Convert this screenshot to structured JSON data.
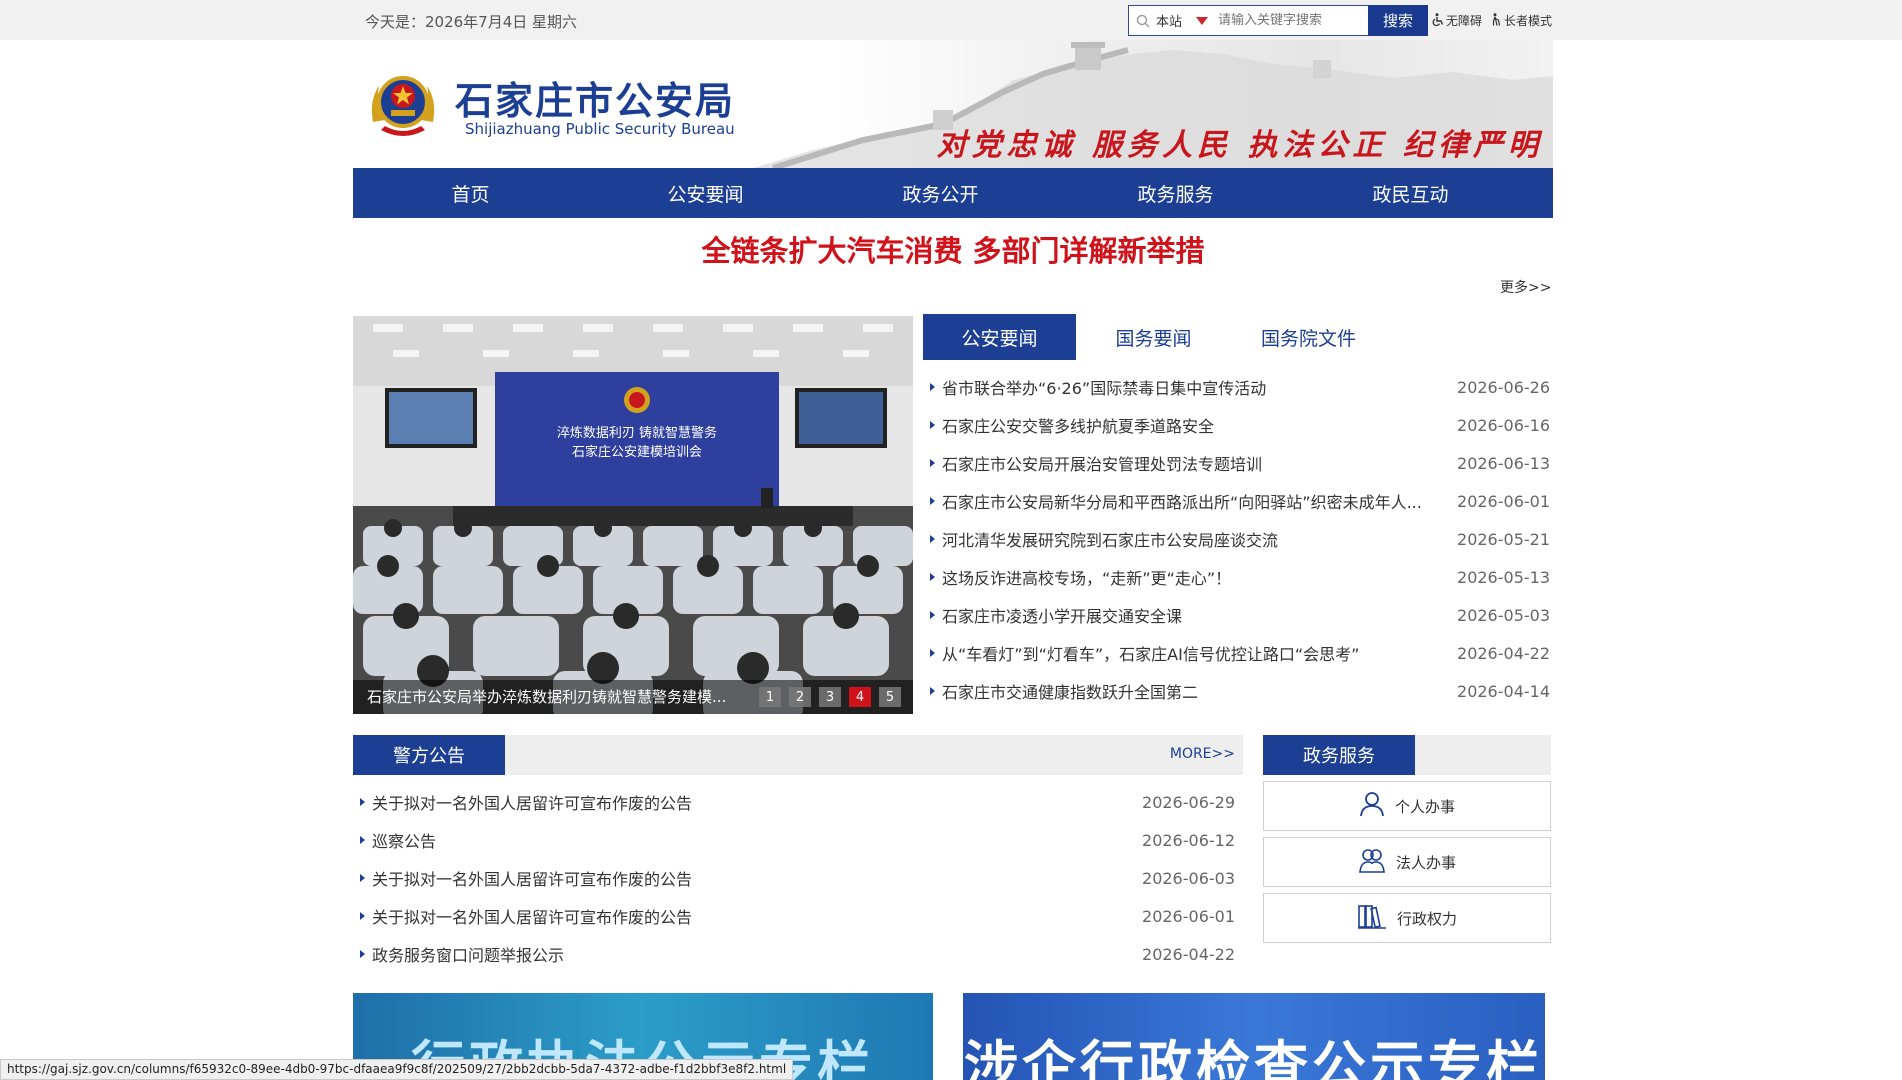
{
  "topbar": {
    "date": "今天是：2026年7月4日 星期六",
    "search_scope": "本站",
    "search_placeholder": "请输入关键字搜索",
    "search_button": "搜索",
    "accessibility_link": "无障碍",
    "elder_mode_link": "长者模式"
  },
  "header": {
    "title": "石家庄市公安局",
    "subtitle": "Shijiazhuang Public Security Bureau",
    "slogan": "对党忠诚 服务人民 执法公正 纪律严明"
  },
  "nav": {
    "items": [
      {
        "label": "首页"
      },
      {
        "label": "公安要闻"
      },
      {
        "label": "政务公开"
      },
      {
        "label": "政务服务"
      },
      {
        "label": "政民互动"
      }
    ]
  },
  "headline": {
    "text": "全链条扩大汽车消费 多部门详解新举措",
    "more": "更多>>"
  },
  "carousel": {
    "screen_text_line1": "淬炼数据利刃 铸就智慧警务",
    "screen_text_line2": "石家庄公安建模培训会",
    "caption": "石家庄市公安局举办淬炼数据利刃铸就智慧警务建模...",
    "pages": [
      "1",
      "2",
      "3",
      "4",
      "5"
    ],
    "active_page": 4
  },
  "news": {
    "tabs": [
      {
        "label": "公安要闻",
        "active": true
      },
      {
        "label": "国务要闻",
        "active": false
      },
      {
        "label": "国务院文件",
        "active": false
      }
    ],
    "items": [
      {
        "title": "省市联合举办“6·26”国际禁毒日集中宣传活动",
        "date": "2026-06-26"
      },
      {
        "title": "石家庄公安交警多线护航夏季道路安全",
        "date": "2026-06-16"
      },
      {
        "title": "石家庄市公安局开展治安管理处罚法专题培训",
        "date": "2026-06-13"
      },
      {
        "title": "石家庄市公安局新华分局和平西路派出所“向阳驿站”织密未成年人...",
        "date": "2026-06-01"
      },
      {
        "title": "河北清华发展研究院到石家庄市公安局座谈交流",
        "date": "2026-05-21"
      },
      {
        "title": "这场反诈进高校专场，“走新”更“走心”！",
        "date": "2026-05-13"
      },
      {
        "title": "石家庄市凌透小学开展交通安全课",
        "date": "2026-05-03"
      },
      {
        "title": "从“车看灯”到“灯看车”，石家庄AI信号优控让路口“会思考”",
        "date": "2026-04-22"
      },
      {
        "title": "石家庄市交通健康指数跃升全国第二",
        "date": "2026-04-14"
      }
    ]
  },
  "notices": {
    "title": "警方公告",
    "more": "MORE>>",
    "items": [
      {
        "title": "关于拟对一名外国人居留许可宣布作废的公告",
        "date": "2026-06-29"
      },
      {
        "title": "巡察公告",
        "date": "2026-06-12"
      },
      {
        "title": "关于拟对一名外国人居留许可宣布作废的公告",
        "date": "2026-06-03"
      },
      {
        "title": "关于拟对一名外国人居留许可宣布作废的公告",
        "date": "2026-06-01"
      },
      {
        "title": "政务服务窗口问题举报公示",
        "date": "2026-04-22"
      }
    ]
  },
  "services": {
    "title": "政务服务",
    "items": [
      {
        "label": "个人办事",
        "icon": "person-icon"
      },
      {
        "label": "法人办事",
        "icon": "corporate-icon"
      },
      {
        "label": "行政权力",
        "icon": "books-icon"
      }
    ]
  },
  "bottom_banners": [
    {
      "text": "行政执法公示专栏"
    },
    {
      "text": "涉企行政检查公示专栏"
    }
  ],
  "status_bar": {
    "url": "https://gaj.sjz.gov.cn/columns/f65932c0-89ee-4db0-97bc-dfaaea9f9c8f/202509/27/2bb2dcbb-5da7-4372-adbe-f1d2bbf3e8f2.html"
  },
  "colors": {
    "brand_blue": "#1c3f94",
    "headline_red": "#d0121b",
    "topbar_bg": "#f1f1f1"
  }
}
